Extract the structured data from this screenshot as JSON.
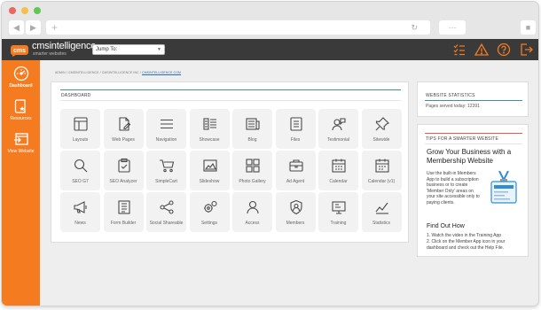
{
  "browser": {
    "traffic_lights": [
      "#e8695f",
      "#f5bf4f",
      "#62c554"
    ],
    "back_icon": "chevron-left-icon",
    "forward_icon": "chevron-right-icon",
    "new_tab_icon": "plus-icon",
    "reload_icon": "reload-icon"
  },
  "brand": {
    "name": "cmsintelligence",
    "tagline": "smarter websites",
    "accent": "#f47b20"
  },
  "topbar": {
    "jump_label": "Jump To:",
    "jump_selected": ""
  },
  "sidebar": {
    "items": [
      {
        "label": "Dashboard",
        "icon": "dashboard-gauge-icon",
        "active": true
      },
      {
        "label": "Resources",
        "icon": "resources-book-icon",
        "active": false
      },
      {
        "label": "View Website",
        "icon": "view-website-icon",
        "active": false
      }
    ]
  },
  "breadcrumb": {
    "prefix": "ADMIN / CMSINTELLIGENCE / CMSINTELLIGENCE INC /",
    "current": "CMSINTELLIGENCE.COM"
  },
  "dashboard": {
    "title": "DASHBOARD",
    "accent_line": "#3a8dc6",
    "tiles": [
      {
        "label": "Layouts",
        "icon": "layouts-icon"
      },
      {
        "label": "Web Pages",
        "icon": "web-pages-icon"
      },
      {
        "label": "Navigation",
        "icon": "navigation-icon"
      },
      {
        "label": "Showcase",
        "icon": "showcase-icon"
      },
      {
        "label": "Blog",
        "icon": "blog-icon"
      },
      {
        "label": "Files",
        "icon": "files-icon"
      },
      {
        "label": "Testimonial",
        "icon": "testimonial-icon"
      },
      {
        "label": "Sitewide",
        "icon": "sitewide-pin-icon"
      },
      {
        "label": "SEO G7",
        "icon": "seo-search-icon"
      },
      {
        "label": "SEO Analyzer",
        "icon": "seo-analyzer-icon"
      },
      {
        "label": "SimpleCart",
        "icon": "cart-icon"
      },
      {
        "label": "Slideshow",
        "icon": "slideshow-icon"
      },
      {
        "label": "Photo Gallery",
        "icon": "photo-gallery-icon"
      },
      {
        "label": "Ad Agent",
        "icon": "ad-agent-icon"
      },
      {
        "label": "Calendar",
        "icon": "calendar-icon"
      },
      {
        "label": "Calendar (v1)",
        "icon": "calendar-v1-icon"
      },
      {
        "label": "News",
        "icon": "news-megaphone-icon"
      },
      {
        "label": "Form Builder",
        "icon": "form-builder-icon"
      },
      {
        "label": "Social Shareable",
        "icon": "share-icon"
      },
      {
        "label": "Settings",
        "icon": "settings-gears-icon"
      },
      {
        "label": "Access",
        "icon": "access-user-icon"
      },
      {
        "label": "Members",
        "icon": "members-badge-icon"
      },
      {
        "label": "Training",
        "icon": "training-icon"
      },
      {
        "label": "Statistics",
        "icon": "statistics-chart-icon"
      }
    ]
  },
  "stats": {
    "title": "WEBSITE STATISTICS",
    "accent_line": "#3a8dc6",
    "pages_served": "Pages served today: 12391"
  },
  "tips": {
    "title": "TIPS FOR A SMARTER WEBSITE",
    "accent_line": "#e05a4e",
    "heading": "Grow Your Business with a Membership Website",
    "body": "Use the built-in Members App to build a subscription business or to create 'Member Only' areas on your site accessible only to paying clients.",
    "find_out": "Find Out How",
    "steps": [
      "1. Watch the video in the Training App",
      "2. Click on the Member App icon in your dashboard and check out the Help File."
    ],
    "badge_icon": "member-badge-illustration"
  }
}
